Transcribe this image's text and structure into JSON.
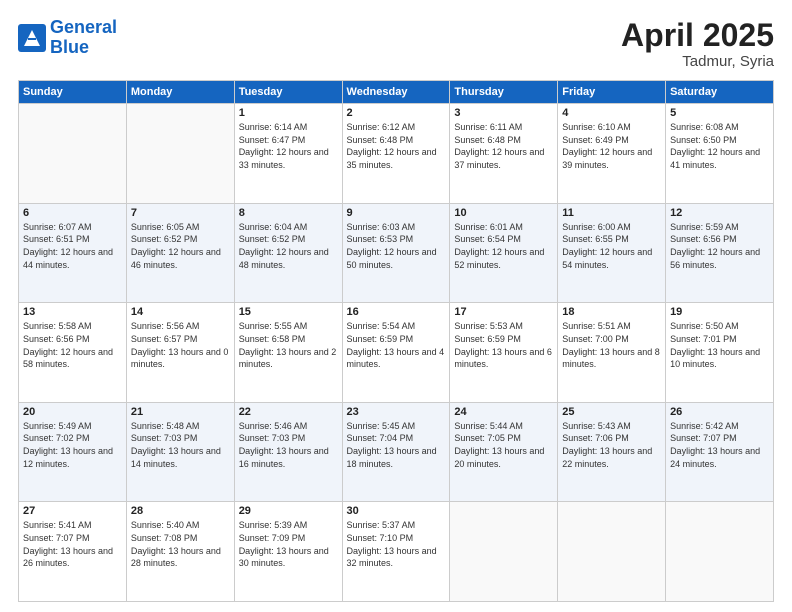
{
  "logo": {
    "line1": "General",
    "line2": "Blue"
  },
  "title": "April 2025",
  "location": "Tadmur, Syria",
  "days_of_week": [
    "Sunday",
    "Monday",
    "Tuesday",
    "Wednesday",
    "Thursday",
    "Friday",
    "Saturday"
  ],
  "weeks": [
    [
      {
        "num": "",
        "info": ""
      },
      {
        "num": "",
        "info": ""
      },
      {
        "num": "1",
        "info": "Sunrise: 6:14 AM\nSunset: 6:47 PM\nDaylight: 12 hours\nand 33 minutes."
      },
      {
        "num": "2",
        "info": "Sunrise: 6:12 AM\nSunset: 6:48 PM\nDaylight: 12 hours\nand 35 minutes."
      },
      {
        "num": "3",
        "info": "Sunrise: 6:11 AM\nSunset: 6:48 PM\nDaylight: 12 hours\nand 37 minutes."
      },
      {
        "num": "4",
        "info": "Sunrise: 6:10 AM\nSunset: 6:49 PM\nDaylight: 12 hours\nand 39 minutes."
      },
      {
        "num": "5",
        "info": "Sunrise: 6:08 AM\nSunset: 6:50 PM\nDaylight: 12 hours\nand 41 minutes."
      }
    ],
    [
      {
        "num": "6",
        "info": "Sunrise: 6:07 AM\nSunset: 6:51 PM\nDaylight: 12 hours\nand 44 minutes."
      },
      {
        "num": "7",
        "info": "Sunrise: 6:05 AM\nSunset: 6:52 PM\nDaylight: 12 hours\nand 46 minutes."
      },
      {
        "num": "8",
        "info": "Sunrise: 6:04 AM\nSunset: 6:52 PM\nDaylight: 12 hours\nand 48 minutes."
      },
      {
        "num": "9",
        "info": "Sunrise: 6:03 AM\nSunset: 6:53 PM\nDaylight: 12 hours\nand 50 minutes."
      },
      {
        "num": "10",
        "info": "Sunrise: 6:01 AM\nSunset: 6:54 PM\nDaylight: 12 hours\nand 52 minutes."
      },
      {
        "num": "11",
        "info": "Sunrise: 6:00 AM\nSunset: 6:55 PM\nDaylight: 12 hours\nand 54 minutes."
      },
      {
        "num": "12",
        "info": "Sunrise: 5:59 AM\nSunset: 6:56 PM\nDaylight: 12 hours\nand 56 minutes."
      }
    ],
    [
      {
        "num": "13",
        "info": "Sunrise: 5:58 AM\nSunset: 6:56 PM\nDaylight: 12 hours\nand 58 minutes."
      },
      {
        "num": "14",
        "info": "Sunrise: 5:56 AM\nSunset: 6:57 PM\nDaylight: 13 hours\nand 0 minutes."
      },
      {
        "num": "15",
        "info": "Sunrise: 5:55 AM\nSunset: 6:58 PM\nDaylight: 13 hours\nand 2 minutes."
      },
      {
        "num": "16",
        "info": "Sunrise: 5:54 AM\nSunset: 6:59 PM\nDaylight: 13 hours\nand 4 minutes."
      },
      {
        "num": "17",
        "info": "Sunrise: 5:53 AM\nSunset: 6:59 PM\nDaylight: 13 hours\nand 6 minutes."
      },
      {
        "num": "18",
        "info": "Sunrise: 5:51 AM\nSunset: 7:00 PM\nDaylight: 13 hours\nand 8 minutes."
      },
      {
        "num": "19",
        "info": "Sunrise: 5:50 AM\nSunset: 7:01 PM\nDaylight: 13 hours\nand 10 minutes."
      }
    ],
    [
      {
        "num": "20",
        "info": "Sunrise: 5:49 AM\nSunset: 7:02 PM\nDaylight: 13 hours\nand 12 minutes."
      },
      {
        "num": "21",
        "info": "Sunrise: 5:48 AM\nSunset: 7:03 PM\nDaylight: 13 hours\nand 14 minutes."
      },
      {
        "num": "22",
        "info": "Sunrise: 5:46 AM\nSunset: 7:03 PM\nDaylight: 13 hours\nand 16 minutes."
      },
      {
        "num": "23",
        "info": "Sunrise: 5:45 AM\nSunset: 7:04 PM\nDaylight: 13 hours\nand 18 minutes."
      },
      {
        "num": "24",
        "info": "Sunrise: 5:44 AM\nSunset: 7:05 PM\nDaylight: 13 hours\nand 20 minutes."
      },
      {
        "num": "25",
        "info": "Sunrise: 5:43 AM\nSunset: 7:06 PM\nDaylight: 13 hours\nand 22 minutes."
      },
      {
        "num": "26",
        "info": "Sunrise: 5:42 AM\nSunset: 7:07 PM\nDaylight: 13 hours\nand 24 minutes."
      }
    ],
    [
      {
        "num": "27",
        "info": "Sunrise: 5:41 AM\nSunset: 7:07 PM\nDaylight: 13 hours\nand 26 minutes."
      },
      {
        "num": "28",
        "info": "Sunrise: 5:40 AM\nSunset: 7:08 PM\nDaylight: 13 hours\nand 28 minutes."
      },
      {
        "num": "29",
        "info": "Sunrise: 5:39 AM\nSunset: 7:09 PM\nDaylight: 13 hours\nand 30 minutes."
      },
      {
        "num": "30",
        "info": "Sunrise: 5:37 AM\nSunset: 7:10 PM\nDaylight: 13 hours\nand 32 minutes."
      },
      {
        "num": "",
        "info": ""
      },
      {
        "num": "",
        "info": ""
      },
      {
        "num": "",
        "info": ""
      }
    ]
  ]
}
